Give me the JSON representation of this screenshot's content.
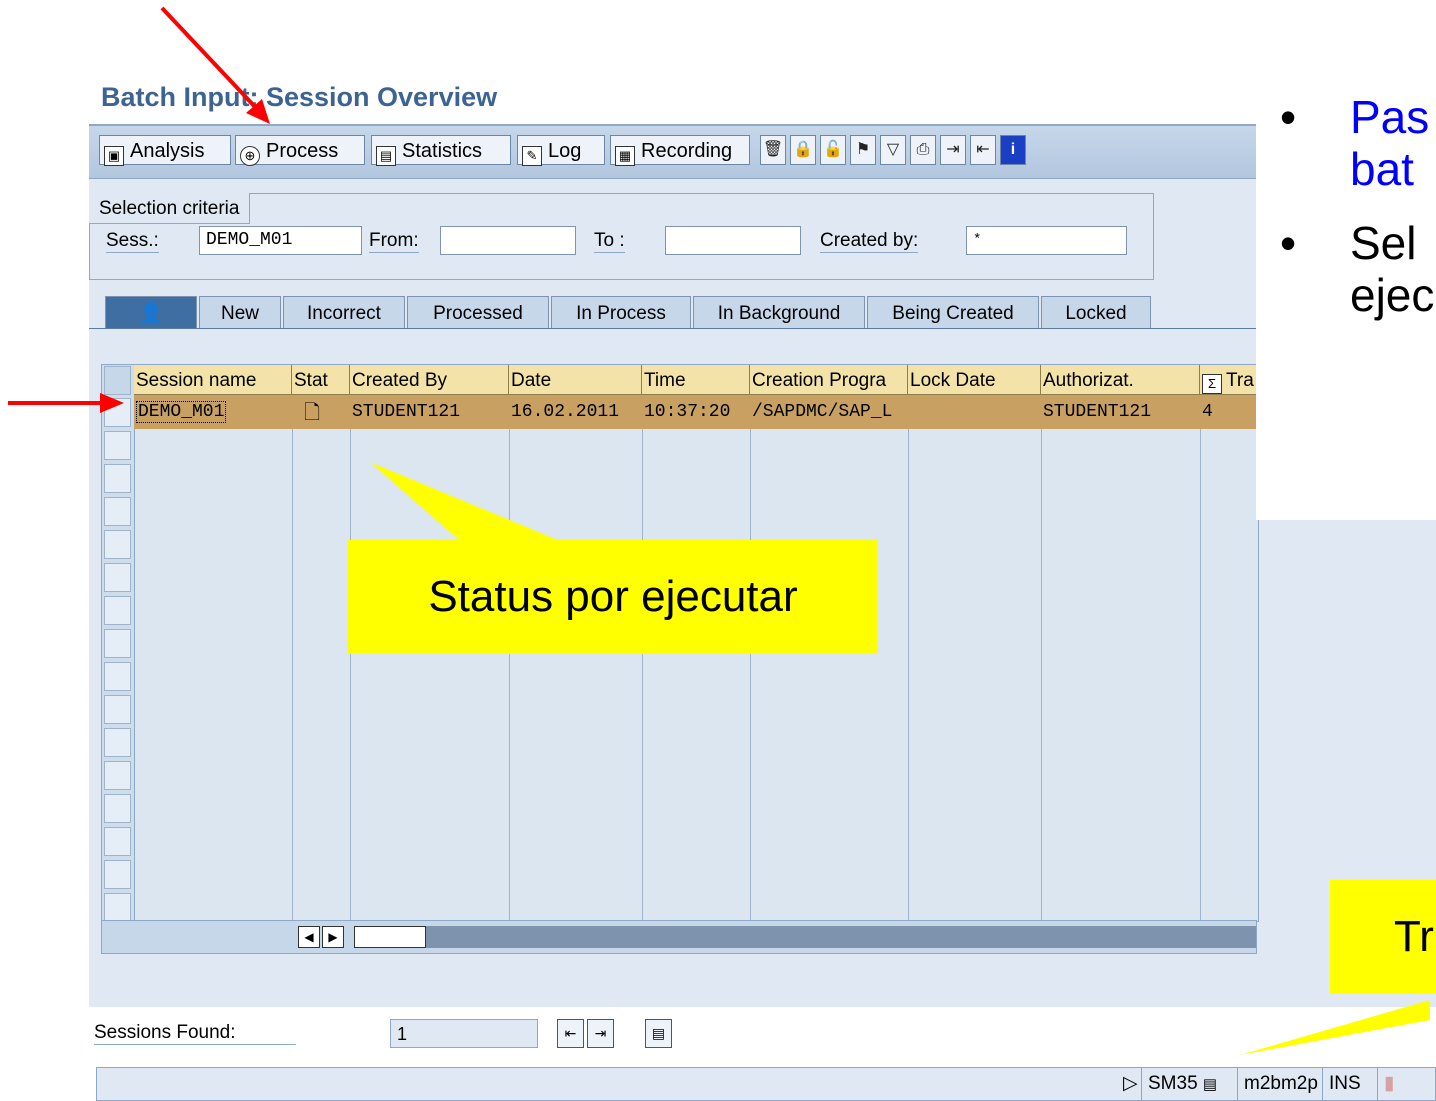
{
  "screen_title": "Batch Input: Session Overview",
  "toolbar": {
    "analysis": "Analysis",
    "process": "Process",
    "statistics": "Statistics",
    "log": "Log",
    "recording": "Recording",
    "icon_buttons": [
      "delete-icon",
      "lock-icon",
      "unlock-icon",
      "flag-icon",
      "filter-icon",
      "print-icon",
      "export-icon",
      "import-icon",
      "info-icon"
    ]
  },
  "selection": {
    "title": "Selection criteria",
    "sess_label": "Sess.:",
    "sess_value": "DEMO_M01",
    "from_label": "From:",
    "from_value": "",
    "to_label": "To :",
    "to_value": "",
    "created_by_label": "Created by:",
    "created_by_value": "*"
  },
  "tabs": [
    "New",
    "Incorrect",
    "Processed",
    "In Process",
    "In Background",
    "Being Created",
    "Locked"
  ],
  "table": {
    "headers": [
      "Session name",
      "Stat",
      "Created By",
      "Date",
      "Time",
      "Creation Progra",
      "Lock Date",
      "Authorizat.",
      "Tra"
    ],
    "row": {
      "session_name": "DEMO_M01",
      "created_by": "STUDENT121",
      "date": "16.02.2011",
      "time": "10:37:20",
      "creation_program": "/SAPDMC/SAP_L",
      "lock_date": "",
      "authorization": "STUDENT121",
      "transactions": "4"
    }
  },
  "footer": {
    "sessions_found_label": "Sessions Found:",
    "sessions_found_value": "1"
  },
  "statusbar": {
    "tcode": "SM35",
    "server": "m2bm2p",
    "mode": "INS"
  },
  "annotations": {
    "bullet1_line1": "Pas",
    "bullet1_line2": "bat",
    "bullet2_line1": "Sel",
    "bullet2_line2": "ejec",
    "callout_status": "Status por ejecutar",
    "callout_bottom": "Tr"
  },
  "colors": {
    "title": "#3c6394",
    "selected_row": "#c8a062",
    "header": "#f3e3a9",
    "callout": "#ffff00",
    "arrow": "#ff0000",
    "bullet_blue": "#0000ff"
  }
}
